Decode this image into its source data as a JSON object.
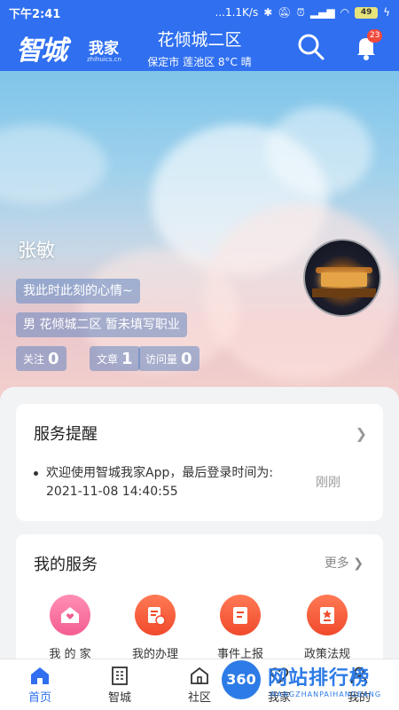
{
  "status_bar": {
    "time": "下午2:41",
    "network_speed": "...1.1K/s",
    "battery": "49"
  },
  "header": {
    "logo_main": "智城",
    "logo_sub": "我家",
    "logo_url": "zhihuics.cn",
    "community": "花倾城二区",
    "weather": "保定市 莲池区 8°C 晴",
    "notification_count": "23"
  },
  "profile": {
    "name": "张敏",
    "mood": "我此时此刻的心情~",
    "info": "男 花倾城二区 暂未填写职业",
    "stats": [
      {
        "label": "关注",
        "value": "0"
      },
      {
        "label": "文章",
        "value": "1"
      },
      {
        "label": "访问量",
        "value": "0"
      }
    ]
  },
  "reminder": {
    "title": "服务提醒",
    "message": "欢迎使用智城我家App，最后登录时间为: 2021-11-08 14:40:55",
    "time": "刚刚"
  },
  "services": {
    "title": "我的服务",
    "more": "更多",
    "items": [
      {
        "label": "我 的 家"
      },
      {
        "label": "我的办理"
      },
      {
        "label": "事件上报"
      },
      {
        "label": "政策法规"
      }
    ]
  },
  "bottom_nav": [
    {
      "label": "首页",
      "icon": "home-icon"
    },
    {
      "label": "智城",
      "icon": "building-icon"
    },
    {
      "label": "社区",
      "icon": "community-icon"
    },
    {
      "label": "我家",
      "icon": "heart-icon"
    },
    {
      "label": "我的",
      "icon": "user-icon"
    }
  ],
  "watermark": {
    "badge": "360",
    "text": "网站排行榜",
    "sub": "WANGZHANPAIHANGBANG"
  },
  "colors": {
    "primary": "#2f6ff0",
    "badge": "#f24a3d"
  }
}
